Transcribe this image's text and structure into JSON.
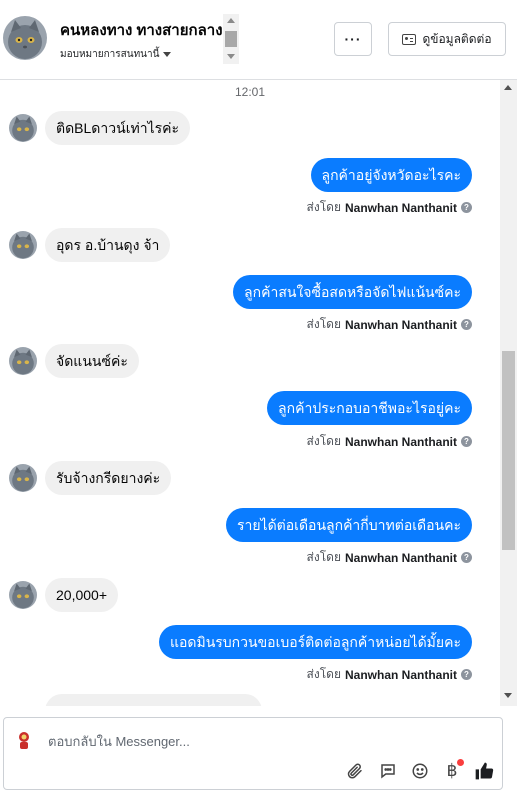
{
  "header": {
    "contact_name": "คนหลงทาง ทางสายกลาง",
    "assign_label": "มอบหมายการสนทนานี้",
    "more_label": "···",
    "contact_info_label": "ดูข้อมูลติดต่อ"
  },
  "conversation": {
    "timestamp": "12:01",
    "sent_by_prefix": "ส่งโดย",
    "sender_name": "Nanwhan Nanthanit",
    "help_glyph": "?",
    "messages": [
      {
        "direction": "in",
        "text": "ติดBLดาวน์เท่าไรค่ะ"
      },
      {
        "direction": "out",
        "text": "ลูกค้าอยู่จังหวัดอะไรคะ"
      },
      {
        "direction": "in",
        "text": "อุดร อ.บ้านดุง จ้า"
      },
      {
        "direction": "out",
        "text": "ลูกค้าสนใจซื้อสดหรือจัดไฟแน้นซ์คะ"
      },
      {
        "direction": "in",
        "text": "จัดแนนซ์ค่ะ"
      },
      {
        "direction": "out",
        "text": "ลูกค้าประกอบอาชีพอะไรอยู่คะ"
      },
      {
        "direction": "in",
        "text": "รับจ้างกรีดยางค่ะ"
      },
      {
        "direction": "out",
        "text": "รายได้ต่อเดือนลูกค้ากี่บาทต่อเดือนคะ"
      },
      {
        "direction": "in",
        "text": "20,000+"
      },
      {
        "direction": "out",
        "text": "แอดมินรบกวนขอเบอร์ติดต่อลูกค้าหน่อยได้มั้ยคะ"
      }
    ]
  },
  "composer": {
    "placeholder": "ตอบกลับใน Messenger...",
    "baht_glyph": "฿"
  },
  "colors": {
    "outgoing_bubble": "#0a7cff",
    "incoming_bubble": "#f0f0f0",
    "like_icon": "#1c1e21",
    "badge": "#fa3e3e"
  },
  "icons": [
    "cat-avatar",
    "ellipsis-icon",
    "contact-card-icon",
    "caret-down-icon",
    "help-icon",
    "attach-icon",
    "chat-bubble-icon",
    "emoji-icon",
    "baht-icon",
    "thumbs-up-icon"
  ]
}
